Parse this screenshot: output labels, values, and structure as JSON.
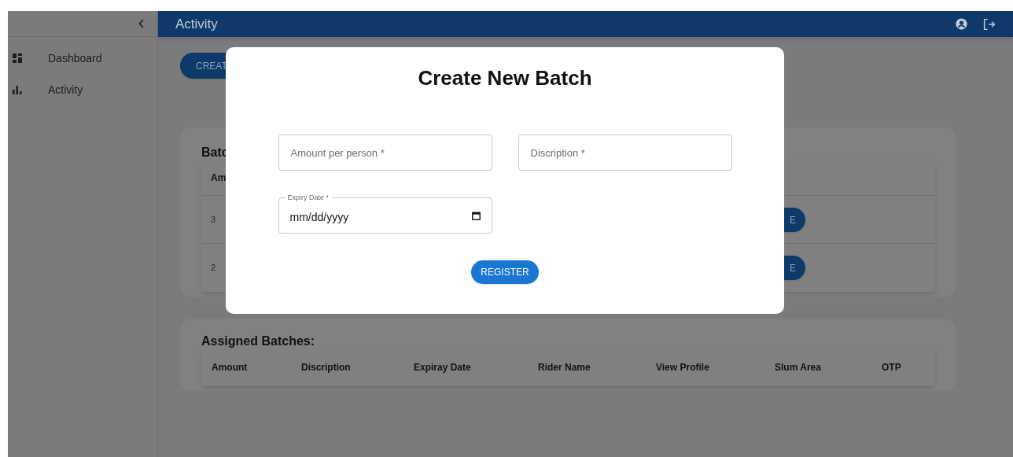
{
  "header": {
    "title": "Activity"
  },
  "sidebar": {
    "items": [
      {
        "label": "Dashboard"
      },
      {
        "label": "Activity"
      }
    ]
  },
  "create_button": "CREAT",
  "batches": {
    "title": "Batc",
    "columns": [
      "Am"
    ],
    "rows": [
      {
        "cells": [
          "3"
        ],
        "action": "E"
      },
      {
        "cells": [
          "2"
        ],
        "action": "E"
      }
    ]
  },
  "assigned": {
    "title": "Assigned Batches:",
    "columns": [
      "Amount",
      "Discription",
      "Expiray Date",
      "Rider Name",
      "View Profile",
      "Slum Area",
      "OTP"
    ]
  },
  "dialog": {
    "title": "Create New Batch",
    "fields": [
      {
        "kind": "text",
        "placeholder": "Amount per person *"
      },
      {
        "kind": "text",
        "placeholder": "Discription *"
      },
      {
        "kind": "date",
        "label": "Expiry Date *",
        "value": "mm/dd/yyyy"
      }
    ],
    "submit": "REGISTER"
  }
}
